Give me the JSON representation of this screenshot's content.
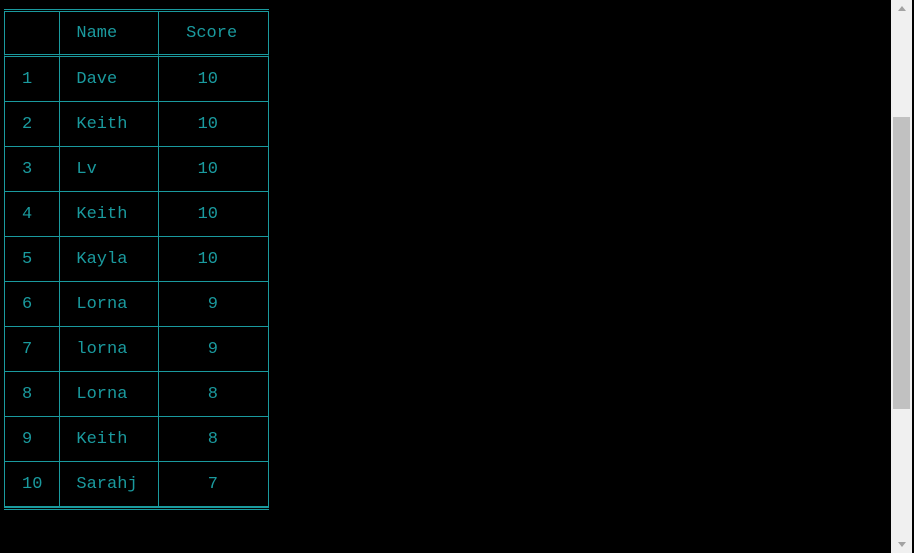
{
  "table": {
    "headers": [
      "",
      "Name",
      "Score"
    ],
    "rows": [
      {
        "rank": "1",
        "name": "Dave",
        "score": "10"
      },
      {
        "rank": "2",
        "name": "Keith",
        "score": "10"
      },
      {
        "rank": "3",
        "name": "Lv",
        "score": "10"
      },
      {
        "rank": "4",
        "name": "Keith",
        "score": "10"
      },
      {
        "rank": "5",
        "name": "Kayla",
        "score": "10"
      },
      {
        "rank": "6",
        "name": "Lorna",
        "score": "9"
      },
      {
        "rank": "7",
        "name": "lorna",
        "score": "9"
      },
      {
        "rank": "8",
        "name": "Lorna",
        "score": "8"
      },
      {
        "rank": "9",
        "name": "Keith",
        "score": "8"
      },
      {
        "rank": "10",
        "name": "Sarahj",
        "score": "7"
      }
    ]
  },
  "colors": {
    "background": "#000000",
    "text_and_borders": "#1a9a9e",
    "scrollbar_track": "#f0f0f0",
    "scrollbar_thumb": "#c1c1c1"
  },
  "scrollbar": {
    "orientation": "vertical"
  }
}
